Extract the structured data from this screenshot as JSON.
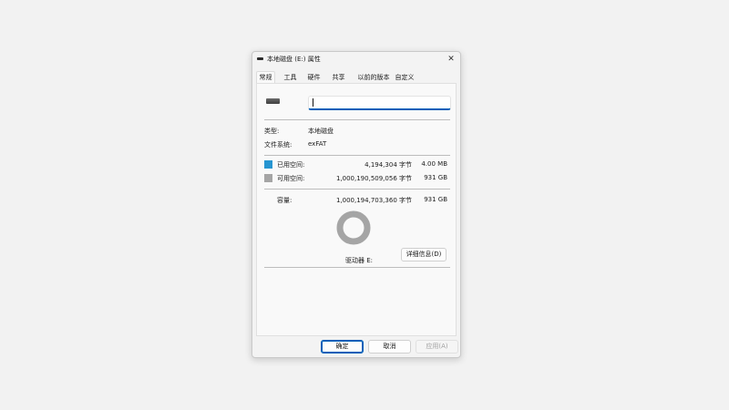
{
  "window": {
    "title": "本地磁盘 (E:) 属性",
    "close_icon": "close-icon"
  },
  "tabs": [
    {
      "label": "常规",
      "active": true
    },
    {
      "label": "工具",
      "active": false
    },
    {
      "label": "硬件",
      "active": false
    },
    {
      "label": "共享",
      "active": false
    },
    {
      "label": "以前的版本",
      "active": false
    },
    {
      "label": "自定义",
      "active": false
    }
  ],
  "general": {
    "drive_icon": "drive-icon",
    "name_value": "",
    "type_label": "类型:",
    "type_value": "本地磁盘",
    "fs_label": "文件系统:",
    "fs_value": "exFAT",
    "used": {
      "label": "已用空间:",
      "bytes": "4,194,304 字节",
      "size": "4.00 MB",
      "color": "#2695d1"
    },
    "free": {
      "label": "可用空间:",
      "bytes": "1,000,190,509,056 字节",
      "size": "931 GB",
      "color": "#a5a5a5"
    },
    "capacity": {
      "label": "容量:",
      "bytes": "1,000,194,703,360 字节",
      "size": "931 GB"
    },
    "drive_caption": "驱动器 E:",
    "details_button": "详细信息(D)",
    "used_fraction": 4.2e-06
  },
  "footer": {
    "ok": "确定",
    "cancel": "取消",
    "apply": "应用(A)"
  }
}
